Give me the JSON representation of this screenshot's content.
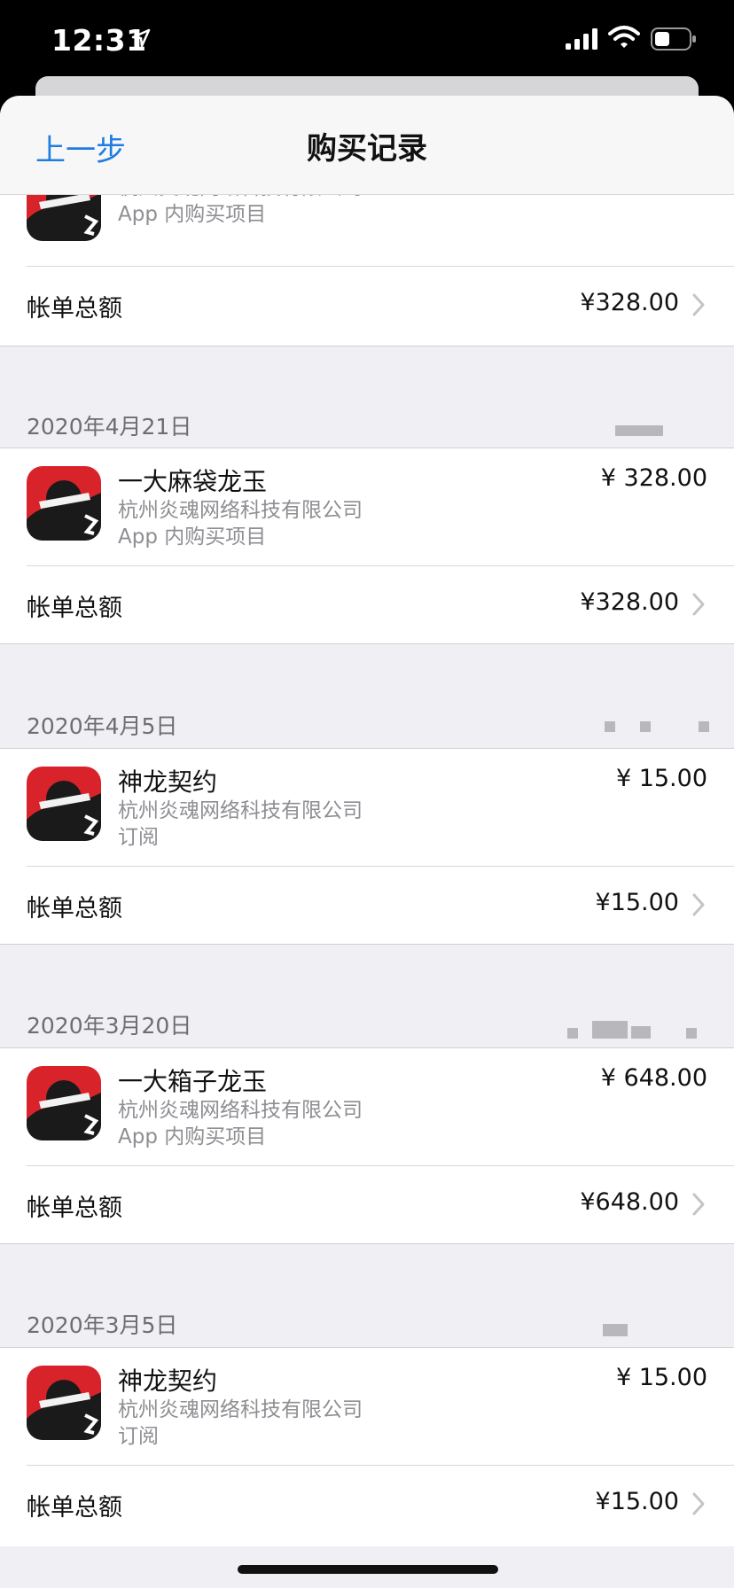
{
  "status_bar": {
    "time": "12:31"
  },
  "nav": {
    "back_label": "上一步",
    "title": "购买记录"
  },
  "top_partial": {
    "company": "杭州炎魂网络科技有限公司",
    "type": "App 内购买项目",
    "total_label": "帐单总额",
    "total_amount": "¥328.00"
  },
  "purchases": [
    {
      "date": "2020年4月21日",
      "name": "一大麻袋龙玉",
      "company": "杭州炎魂网络科技有限公司",
      "type": "App 内购买项目",
      "price": "¥ 328.00",
      "total_label": "帐单总额",
      "total_amount": "¥328.00"
    },
    {
      "date": "2020年4月5日",
      "name": "神龙契约",
      "company": "杭州炎魂网络科技有限公司",
      "type": "订阅",
      "price": "¥ 15.00",
      "total_label": "帐单总额",
      "total_amount": "¥15.00"
    },
    {
      "date": "2020年3月20日",
      "name": "一大箱子龙玉",
      "company": "杭州炎魂网络科技有限公司",
      "type": "App 内购买项目",
      "price": "¥ 648.00",
      "total_label": "帐单总额",
      "total_amount": "¥648.00"
    },
    {
      "date": "2020年3月5日",
      "name": "神龙契约",
      "company": "杭州炎魂网络科技有限公司",
      "type": "订阅",
      "price": "¥ 15.00",
      "total_label": "帐单总额",
      "total_amount": "¥15.00"
    }
  ],
  "icons": {
    "app": "ninja-app-icon",
    "chevron": "chevron-right-icon",
    "location": "location-arrow-icon",
    "signal": "cellular-signal-icon",
    "wifi": "wifi-icon",
    "battery": "battery-icon"
  },
  "colors": {
    "accent": "#1f7ce0",
    "background": "#efeff4",
    "secondary_text": "#8e8e93",
    "app_icon_red": "#d8232a"
  }
}
